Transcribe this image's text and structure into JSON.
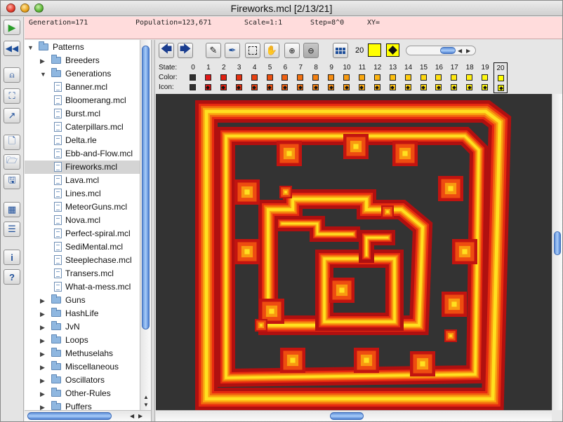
{
  "window": {
    "title": "Fireworks.mcl [2/13/21]"
  },
  "status": {
    "generation": "Generation=171",
    "population": "Population=123,671",
    "scale": "Scale=1:1",
    "step": "Step=8^0",
    "xy": "XY="
  },
  "tree": {
    "root": "Patterns",
    "items": [
      {
        "label": "Patterns",
        "kind": "folder",
        "level": 0,
        "open": true
      },
      {
        "label": "Breeders",
        "kind": "folder",
        "level": 1,
        "open": false
      },
      {
        "label": "Generations",
        "kind": "folder",
        "level": 1,
        "open": true
      },
      {
        "label": "Banner.mcl",
        "kind": "file",
        "level": 2
      },
      {
        "label": "Bloomerang.mcl",
        "kind": "file",
        "level": 2
      },
      {
        "label": "Burst.mcl",
        "kind": "file",
        "level": 2
      },
      {
        "label": "Caterpillars.mcl",
        "kind": "file",
        "level": 2
      },
      {
        "label": "Delta.rle",
        "kind": "file",
        "level": 2
      },
      {
        "label": "Ebb-and-Flow.mcl",
        "kind": "file",
        "level": 2
      },
      {
        "label": "Fireworks.mcl",
        "kind": "file",
        "level": 2,
        "selected": true
      },
      {
        "label": "Lava.mcl",
        "kind": "file",
        "level": 2
      },
      {
        "label": "Lines.mcl",
        "kind": "file",
        "level": 2
      },
      {
        "label": "MeteorGuns.mcl",
        "kind": "file",
        "level": 2
      },
      {
        "label": "Nova.mcl",
        "kind": "file",
        "level": 2
      },
      {
        "label": "Perfect-spiral.mcl",
        "kind": "file",
        "level": 2
      },
      {
        "label": "SediMental.mcl",
        "kind": "file",
        "level": 2
      },
      {
        "label": "Steeplechase.mcl",
        "kind": "file",
        "level": 2
      },
      {
        "label": "Transers.mcl",
        "kind": "file",
        "level": 2
      },
      {
        "label": "What-a-mess.mcl",
        "kind": "file",
        "level": 2
      },
      {
        "label": "Guns",
        "kind": "folder",
        "level": 1,
        "open": false
      },
      {
        "label": "HashLife",
        "kind": "folder",
        "level": 1,
        "open": false
      },
      {
        "label": "JvN",
        "kind": "folder",
        "level": 1,
        "open": false
      },
      {
        "label": "Loops",
        "kind": "folder",
        "level": 1,
        "open": false
      },
      {
        "label": "Methuselahs",
        "kind": "folder",
        "level": 1,
        "open": false
      },
      {
        "label": "Miscellaneous",
        "kind": "folder",
        "level": 1,
        "open": false
      },
      {
        "label": "Oscillators",
        "kind": "folder",
        "level": 1,
        "open": false
      },
      {
        "label": "Other-Rules",
        "kind": "folder",
        "level": 1,
        "open": false
      },
      {
        "label": "Puffers",
        "kind": "folder",
        "level": 1,
        "open": false
      }
    ]
  },
  "left_toolbar": [
    {
      "name": "start-generating-button",
      "icon": "play-icon"
    },
    {
      "name": "reset-button",
      "icon": "rewind-icon"
    },
    {
      "name": "tool-menu-button",
      "icon": "hand-menu-icon"
    },
    {
      "name": "fit-pattern-button",
      "icon": "fit-icon"
    },
    {
      "name": "show-stats-button",
      "icon": "stats-icon"
    },
    {
      "name": "new-pattern-button",
      "icon": "new-file-icon"
    },
    {
      "name": "open-pattern-button",
      "icon": "open-file-icon"
    },
    {
      "name": "save-pattern-button",
      "icon": "save-icon"
    },
    {
      "name": "show-patterns-button",
      "icon": "patterns-icon"
    },
    {
      "name": "show-scripts-button",
      "icon": "scripts-icon"
    },
    {
      "name": "show-info-button",
      "icon": "info-icon"
    },
    {
      "name": "help-button",
      "icon": "help-icon"
    }
  ],
  "edit_toolbar": {
    "icons": [
      "back-arrow-icon",
      "forward-arrow-icon",
      "pencil-icon",
      "eyedropper-icon",
      "select-icon",
      "hand-icon",
      "zoom-in-icon",
      "zoom-out-icon",
      "all-states-icon"
    ],
    "current_state": "20",
    "current_color": "#ffff00",
    "icon_mode": "diamond"
  },
  "states": {
    "state_label": "State:",
    "color_label": "Color:",
    "icon_label": "Icon:",
    "numbers": [
      "0",
      "1",
      "2",
      "3",
      "4",
      "5",
      "6",
      "7",
      "8",
      "9",
      "10",
      "11",
      "12",
      "13",
      "14",
      "15",
      "16",
      "17",
      "18",
      "19",
      "20"
    ],
    "colors": [
      "#303030",
      "#e01818",
      "#e02010",
      "#e43010",
      "#e84010",
      "#ec5010",
      "#f06010",
      "#f27010",
      "#f48010",
      "#f68c10",
      "#f89a10",
      "#faa810",
      "#fcb410",
      "#fdc010",
      "#fecc10",
      "#fed810",
      "#ffe010",
      "#ffe810",
      "#fff010",
      "#fff810",
      "#ffff00"
    ],
    "selected": "20"
  },
  "view": {
    "background": "#333333"
  }
}
